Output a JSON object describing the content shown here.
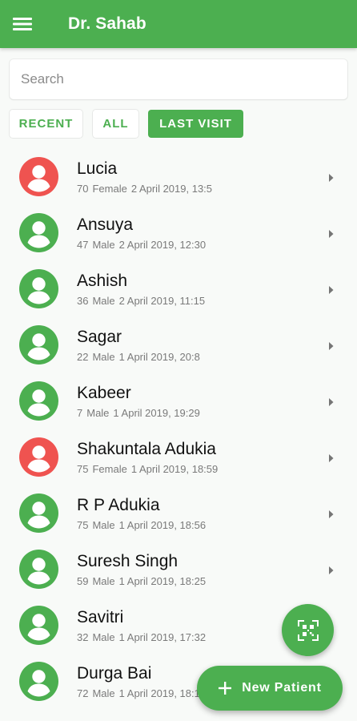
{
  "app": {
    "title": "Dr. Sahab"
  },
  "colors": {
    "primary": "#4caf50",
    "female_avatar": "#ef5350",
    "male_avatar": "#4caf50"
  },
  "search": {
    "placeholder": "Search",
    "value": ""
  },
  "filters": [
    {
      "label": "RECENT",
      "selected": false
    },
    {
      "label": "ALL",
      "selected": false
    },
    {
      "label": "LAST VISIT",
      "selected": true
    }
  ],
  "patients": [
    {
      "name": "Lucia",
      "age": "70",
      "gender": "Female",
      "last_visit": "2 April 2019, 13:5"
    },
    {
      "name": "Ansuya",
      "age": "47",
      "gender": "Male",
      "last_visit": "2 April 2019, 12:30"
    },
    {
      "name": "Ashish",
      "age": "36",
      "gender": "Male",
      "last_visit": "2 April 2019, 11:15"
    },
    {
      "name": "Sagar",
      "age": "22",
      "gender": "Male",
      "last_visit": "1 April 2019, 20:8"
    },
    {
      "name": "Kabeer",
      "age": "7",
      "gender": "Male",
      "last_visit": "1 April 2019, 19:29"
    },
    {
      "name": "Shakuntala Adukia",
      "age": "75",
      "gender": "Female",
      "last_visit": "1 April 2019, 18:59"
    },
    {
      "name": "R P Adukia",
      "age": "75",
      "gender": "Male",
      "last_visit": "1 April 2019, 18:56"
    },
    {
      "name": "Suresh Singh",
      "age": "59",
      "gender": "Male",
      "last_visit": "1 April 2019, 18:25"
    },
    {
      "name": "Savitri",
      "age": "32",
      "gender": "Male",
      "last_visit": "1 April 2019, 17:32"
    },
    {
      "name": "Durga Bai",
      "age": "72",
      "gender": "Male",
      "last_visit": "1 April 2019, 18:11"
    }
  ],
  "fab": {
    "scan_icon": "qr-scan-icon",
    "new_patient_label": "New Patient",
    "new_patient_icon": "plus-icon"
  },
  "icons": {
    "menu": "menu-icon",
    "avatar": "person-avatar-icon",
    "chevron": "chevron-right-icon"
  }
}
